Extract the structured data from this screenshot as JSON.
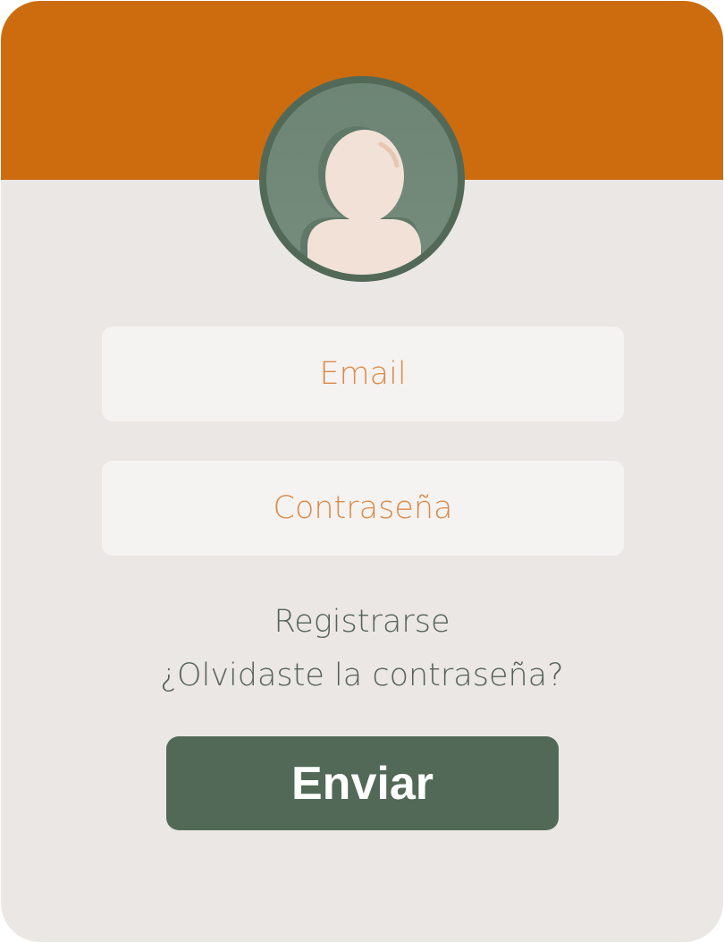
{
  "form": {
    "email_placeholder": "Email",
    "password_placeholder": "Contraseña",
    "register_link": "Registrarse",
    "forgot_link": "¿Olvidaste la contraseña?",
    "submit_label": "Enviar"
  },
  "colors": {
    "header": "#cc6c0f",
    "background": "#ebe7e4",
    "field_background": "#f5f3f1",
    "placeholder_text": "#db8a48",
    "link_text": "#55625a",
    "button": "#526957",
    "avatar_ring": "#526957",
    "avatar_fill": "#6f8878",
    "avatar_skin": "#f1e1d6"
  },
  "icons": {
    "avatar": "user-avatar-icon"
  }
}
